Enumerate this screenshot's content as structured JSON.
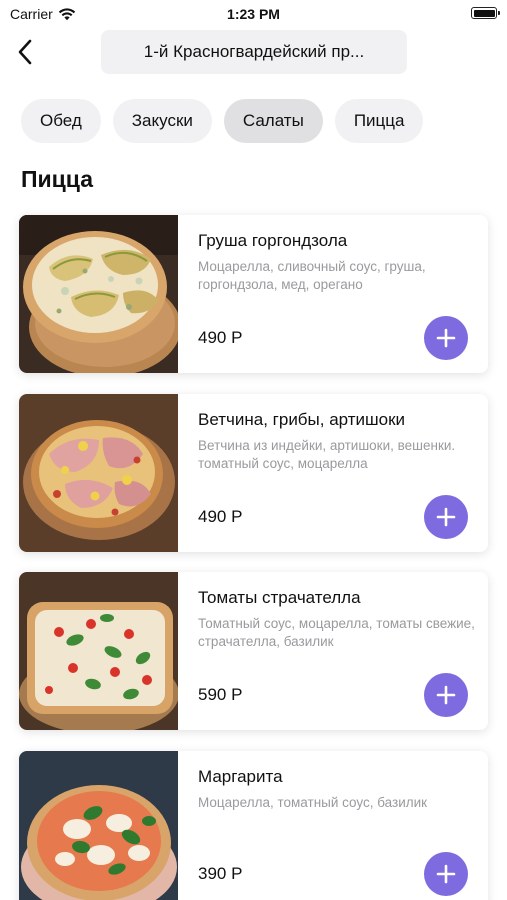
{
  "status_bar": {
    "carrier": "Carrier",
    "time": "1:23 PM"
  },
  "header": {
    "address": "1-й Красногвардейский пр..."
  },
  "categories": [
    {
      "label": "Обед",
      "active": false
    },
    {
      "label": "Закуски",
      "active": false
    },
    {
      "label": "Салаты",
      "active": true
    },
    {
      "label": "Пицца",
      "active": false
    }
  ],
  "section_title": "Пицца",
  "products": [
    {
      "name": "Груша горгондзола",
      "description": "Моцарелла, сливочный соус, груша, горгондзола, мед, орегано",
      "price": "490 Р"
    },
    {
      "name": "Ветчина, грибы, артишоки",
      "description": "Ветчина из индейки, артишоки, вешенки. томатный соус, моцарелла",
      "price": "490 Р"
    },
    {
      "name": "Томаты страчателла",
      "description": "Томатный соус, моцарелла, томаты свежие, страчателла, базилик",
      "price": "590 Р"
    },
    {
      "name": "Маргарита",
      "description": "Моцарелла, томатный соус, базилик",
      "price": "390 Р"
    }
  ],
  "colors": {
    "accent": "#7e6be0",
    "chip_bg": "#f1f1f3",
    "chip_active_bg": "#e0e0e2",
    "muted_text": "#9a9a9e"
  },
  "icons": {
    "back": "chevron-left-icon",
    "add": "plus-icon",
    "wifi": "wifi-icon",
    "battery": "battery-icon"
  }
}
